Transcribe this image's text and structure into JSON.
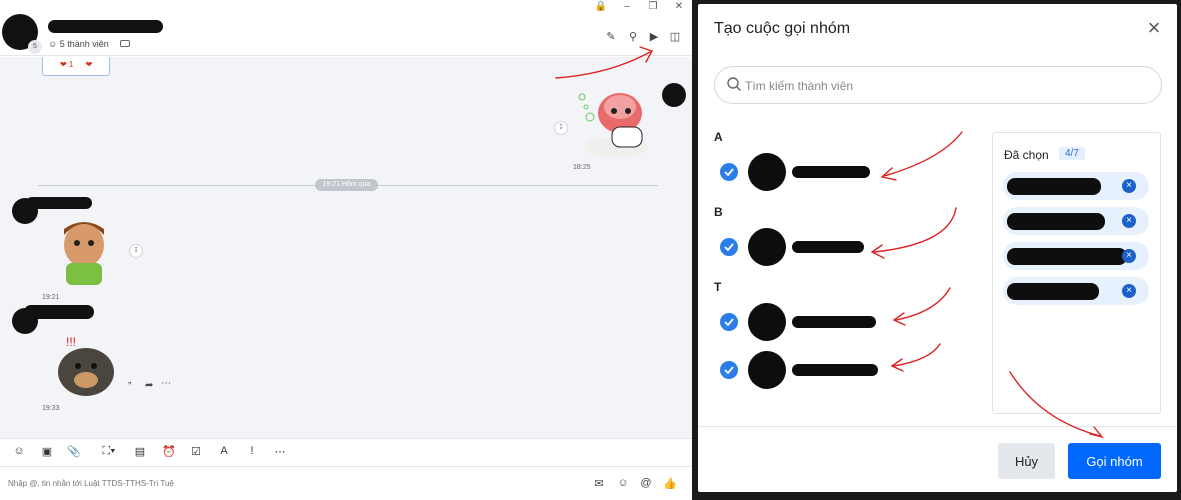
{
  "colors": {
    "accent": "#0068ff",
    "check": "#2b7de9",
    "annotation": "#e02020"
  },
  "chat": {
    "header": {
      "member_count": "5 thành viên",
      "member_badge": "5"
    },
    "messages": {
      "reaction": "❤ 1",
      "time_1": "18:25",
      "date_separator": "19:21 Hôm qua",
      "time_2": "19:21",
      "time_3": "19:33"
    },
    "composer": {
      "placeholder": "Nhập @, tin nhắn tới Luật TTDS-TTHS-Trí Tuệ"
    }
  },
  "modal": {
    "title": "Tạo cuộc gọi nhóm",
    "search_placeholder": "Tìm kiếm thành viên",
    "sections": [
      {
        "letter": "A"
      },
      {
        "letter": "B"
      },
      {
        "letter": "T"
      }
    ],
    "selected_label": "Đã chọn",
    "selected_count": "4/7",
    "cancel_label": "Hủy",
    "call_label": "Gọi nhóm"
  }
}
